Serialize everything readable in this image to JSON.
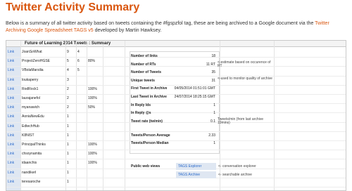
{
  "page": {
    "title": "Twitter Activity Summary",
    "intro_before": "Below is a summary of all twitter activity based on tweets containing the #fgspzfol tag, these are being archived to a Google document via the ",
    "intro_link": "Twitter Archiving Google Spreadsheet TAGS v5",
    "intro_after": " developed by Martin Hawksey."
  },
  "sheet": {
    "title": "Future of Learning 2014 Tweets : Summary",
    "link_label": "Link",
    "rows": [
      {
        "name": "JoanSoWhat",
        "c1": "9",
        "c2": "4",
        "c3": ""
      },
      {
        "name": "ProjectZeroHGSE",
        "c1": "5",
        "c2": "6",
        "c3": "80%"
      },
      {
        "name": "VBolaMarsilia",
        "c1": "4",
        "c2": "5",
        "c3": ""
      },
      {
        "name": "loukaperry",
        "c1": "3",
        "c2": "",
        "c3": ""
      },
      {
        "name": "RodRock1",
        "c1": "2",
        "c2": "",
        "c3": "100%"
      },
      {
        "name": "laurajanefol",
        "c1": "2",
        "c2": "",
        "c3": "100%"
      },
      {
        "name": "myanawich",
        "c1": "2",
        "c2": "",
        "c3": "50%"
      },
      {
        "name": "AoniaNewEdu",
        "c1": "1",
        "c2": "",
        "c3": ""
      },
      {
        "name": "EdtechHub",
        "c1": "1",
        "c2": "",
        "c3": ""
      },
      {
        "name": "K8NIST",
        "c1": "1",
        "c2": "",
        "c3": ""
      },
      {
        "name": "PrincipalThinks",
        "c1": "1",
        "c2": "",
        "c3": "100%"
      },
      {
        "name": "chsoynamita",
        "c1": "1",
        "c2": "",
        "c3": "100%"
      },
      {
        "name": "idaanchis",
        "c1": "1",
        "c2": "",
        "c3": "100%"
      },
      {
        "name": "nandikerl",
        "c1": "1",
        "c2": "",
        "c3": ""
      },
      {
        "name": "teresaroche",
        "c1": "1",
        "c2": "",
        "c3": ""
      }
    ]
  },
  "stats": [
    {
      "key": "Number of links",
      "value": "18",
      "note": ""
    },
    {
      "key": "Number of RTs",
      "value": "11 RT",
      "note": "<-estimate based on occurence of RT"
    },
    {
      "key": "Number of Tweets",
      "value": "35",
      "note": ""
    },
    {
      "key": "Unique tweets",
      "value": "31",
      "note": "<-used to monitor quality of archive"
    },
    {
      "key": "First Tweet in Archive",
      "value": "04/05/2014 01:51:01 GMT",
      "note": ""
    },
    {
      "key": "Last Tweet in Archive",
      "value": "24/07/2014 18:25:15 GMT",
      "note": ""
    },
    {
      "key": "In Reply Ids",
      "value": "1",
      "note": ""
    },
    {
      "key": "In Reply @s",
      "value": "1",
      "note": ""
    },
    {
      "key": "Tweet rate (tw/min)",
      "value": "0.1",
      "note": "Tweets/min (from last archive 10mins)"
    },
    {
      "key": "Tweets/Person Average",
      "value": "2.33",
      "note": ""
    },
    {
      "key": "Tweets/Person Median",
      "value": "1",
      "note": ""
    }
  ],
  "views": {
    "label": "Public web views",
    "items": [
      {
        "button": "TAGS Explorer",
        "note": "<- conversation explorer"
      },
      {
        "button": "TAGS Archive",
        "note": "<- searchable archive"
      }
    ]
  }
}
